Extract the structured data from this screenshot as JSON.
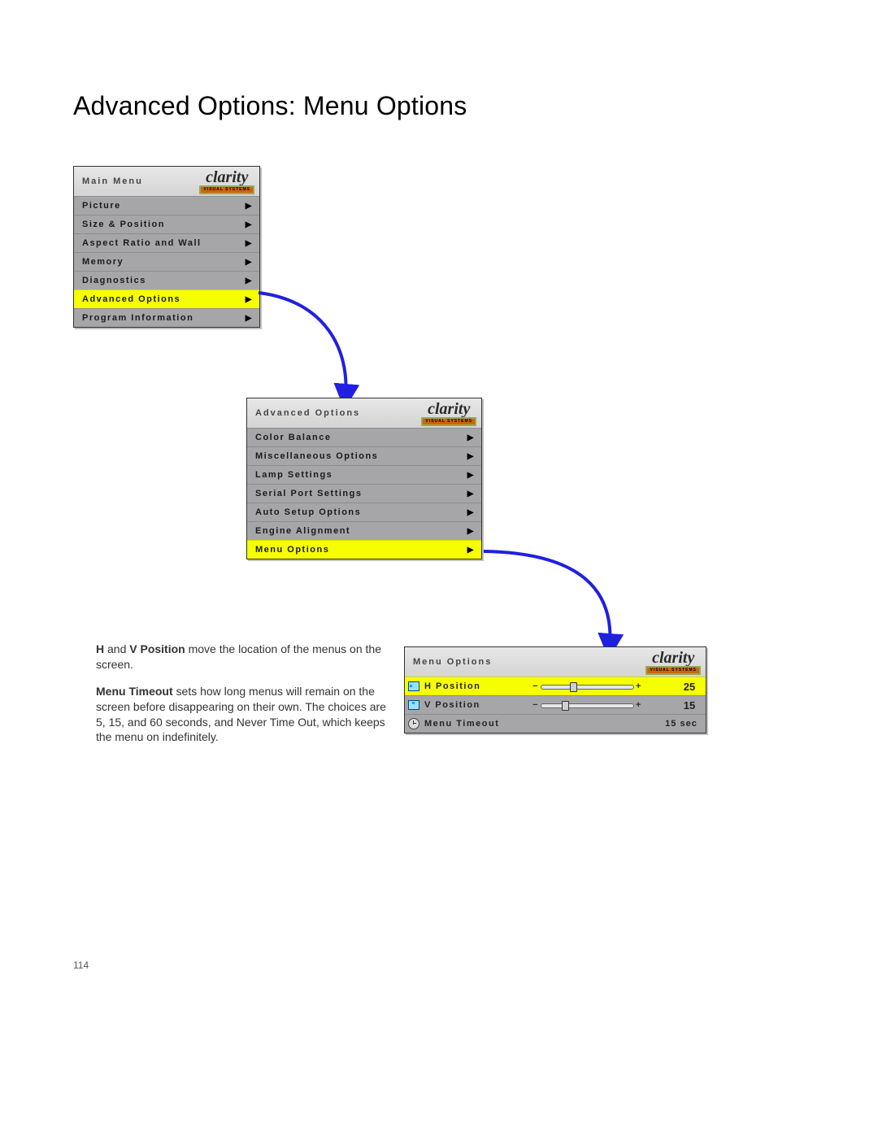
{
  "title": "Advanced Options: Menu Options",
  "logo": {
    "word": "clarity",
    "bar": "VISUAL SYSTEMS"
  },
  "mainMenu": {
    "title": "Main Menu",
    "items": [
      {
        "label": "Picture"
      },
      {
        "label": "Size & Position"
      },
      {
        "label": "Aspect Ratio and Wall"
      },
      {
        "label": "Memory"
      },
      {
        "label": "Diagnostics"
      },
      {
        "label": "Advanced Options"
      },
      {
        "label": "Program Information"
      }
    ]
  },
  "advMenu": {
    "title": "Advanced Options",
    "items": [
      {
        "label": "Color Balance"
      },
      {
        "label": "Miscellaneous Options"
      },
      {
        "label": "Lamp Settings"
      },
      {
        "label": "Serial Port Settings"
      },
      {
        "label": "Auto Setup Options"
      },
      {
        "label": "Engine Alignment"
      },
      {
        "label": "Menu Options"
      }
    ]
  },
  "menuOptions": {
    "title": "Menu Options",
    "rows": [
      {
        "label": "H Position",
        "minus": "−",
        "plus": "+",
        "value": "25",
        "thumb": 36
      },
      {
        "label": "V Position",
        "minus": "−",
        "plus": "+",
        "value": "15",
        "thumb": 26
      },
      {
        "label": "Menu Timeout",
        "value": "15 sec"
      }
    ]
  },
  "body": {
    "p1a": "H",
    "p1b": " and ",
    "p1c": "V Position",
    "p1d": " move the location of the menus on the screen.",
    "p2a": "Menu Timeout",
    "p2b": " sets how long menus will remain on the screen before disappearing on their own. The choices are 5, 15, and 60 seconds, and Never Time Out, which keeps the menu on indefinitely."
  },
  "pageNumber": "114"
}
